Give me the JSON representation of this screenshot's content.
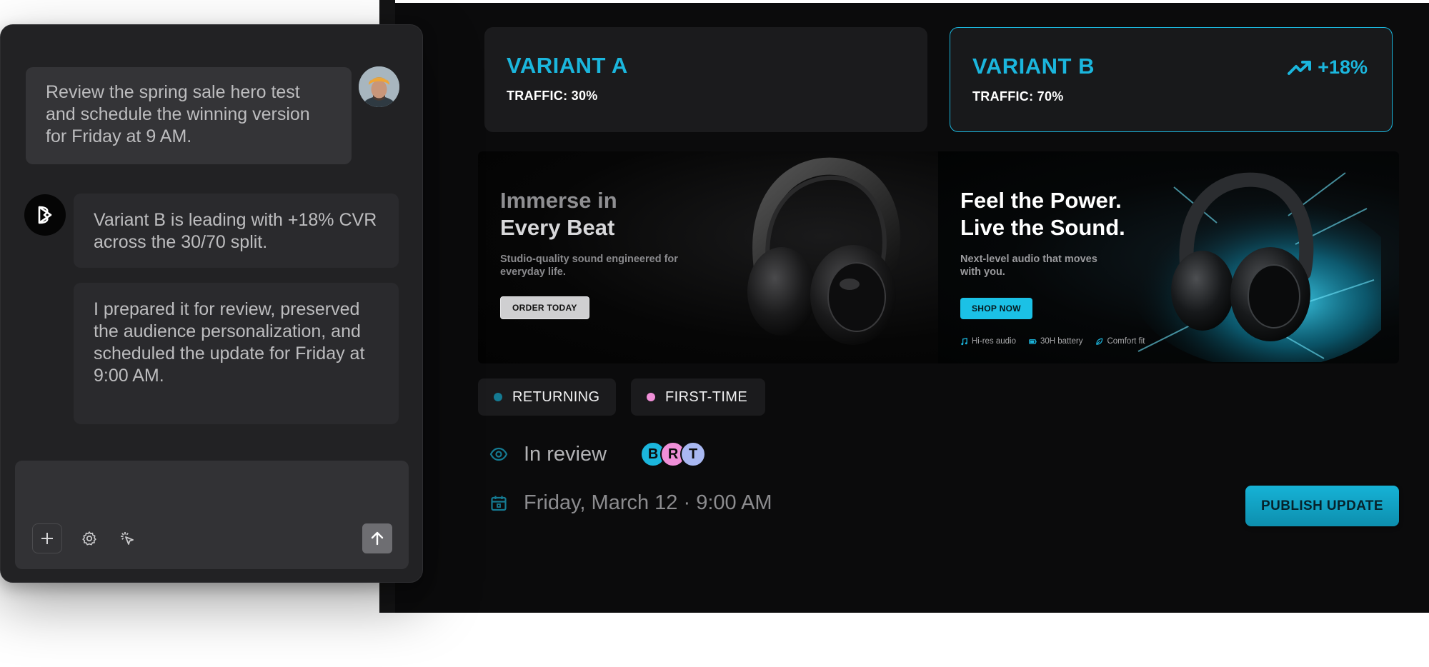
{
  "chat": {
    "user_message": "Review the spring sale hero test and schedule the winning version for Friday at 9 AM.",
    "bot_messages": [
      "Variant B is leading with +18% CVR across the 30/70 split.",
      "I prepared it for review, preserved the audience personalization, and scheduled the update for Friday at 9:00 AM."
    ],
    "composer_placeholder": ""
  },
  "variants": {
    "a": {
      "title": "VARIANT A",
      "traffic": "TRAFFIC: 30%"
    },
    "b": {
      "title": "VARIANT B",
      "traffic": "TRAFFIC: 70%",
      "lift": "+18%"
    }
  },
  "heroes": {
    "a": {
      "title_line1": "Immerse in",
      "title_line2": "Every Beat",
      "subtitle": "Studio-quality sound engineered for everyday life.",
      "cta": "ORDER TODAY"
    },
    "b": {
      "title_line1": "Feel the Power.",
      "title_line2": "Live the Sound.",
      "subtitle": "Next-level audio that moves with you.",
      "cta": "SHOP NOW",
      "features": [
        "Hi-res audio",
        "30H battery",
        "Comfort fit"
      ]
    }
  },
  "segments": [
    {
      "label": "RETURNING",
      "color": "#157a92"
    },
    {
      "label": "FIRST-TIME",
      "color": "#f08fd8"
    }
  ],
  "status": {
    "review_label": "In review",
    "reviewers": [
      {
        "initial": "B",
        "color": "#1bb6dd"
      },
      {
        "initial": "R",
        "color": "#f08fd8"
      },
      {
        "initial": "T",
        "color": "#a9b8f2"
      }
    ],
    "schedule": "Friday, March 12 · 9:00 AM"
  },
  "actions": {
    "publish": "PUBLISH UPDATE"
  },
  "colors": {
    "accent": "#1bb6dd",
    "background": "#0b0b0c"
  }
}
